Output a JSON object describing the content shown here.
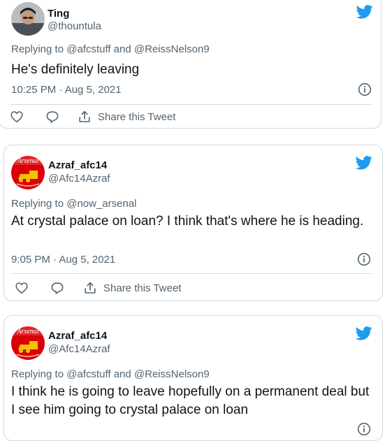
{
  "colors": {
    "twitter_blue": "#1d9bf0",
    "secondary_text": "#536471",
    "border": "#cfd9de",
    "arsenal_red": "#db0007"
  },
  "tweets": [
    {
      "name": "Ting",
      "handle": "@thountula",
      "avatar": "person-photo",
      "replying_prefix": "Replying to",
      "replying_to": [
        "@afcstuff",
        "@ReissNelson9"
      ],
      "replying_joiner": "and",
      "text": "He's definitely leaving",
      "timestamp": "10:25 PM · Aug 5, 2021",
      "share_label": "Share this Tweet"
    },
    {
      "name": "Azraf_afc14",
      "handle": "@Afc14Azraf",
      "avatar": "arsenal-crest",
      "avatar_text": "Arsenal",
      "replying_prefix": "Replying to",
      "replying_to": [
        "@now_arsenal"
      ],
      "text": "At crystal palace on loan? I think that's where he is heading.",
      "timestamp": "9:05 PM · Aug 5, 2021",
      "share_label": "Share this Tweet"
    },
    {
      "name": "Azraf_afc14",
      "handle": "@Afc14Azraf",
      "avatar": "arsenal-crest",
      "avatar_text": "Arsenal",
      "replying_prefix": "Replying to",
      "replying_to": [
        "@afcstuff",
        "@ReissNelson9"
      ],
      "replying_joiner": "and",
      "text": "I think he is going to leave hopefully on a permanent deal but I see him going to crystal palace on loan"
    }
  ]
}
